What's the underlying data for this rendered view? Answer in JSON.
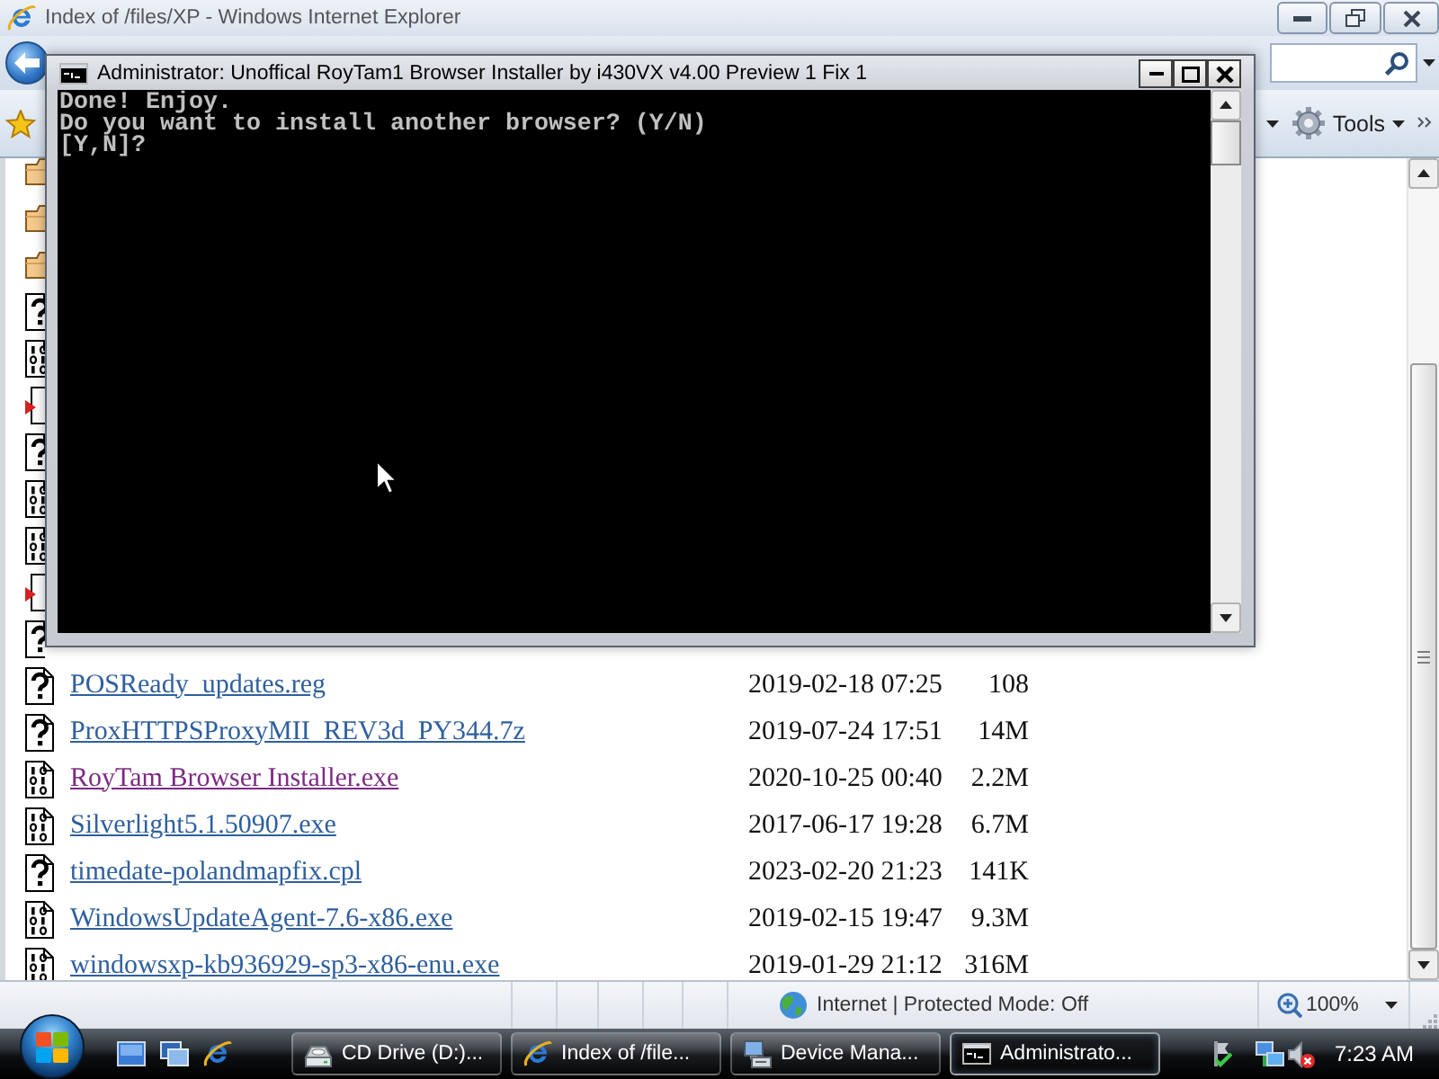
{
  "browser": {
    "title": "Index of /files/XP - Windows Internet Explorer",
    "command_bar": {
      "tools": "Tools"
    },
    "file_rows": [
      {
        "kind": "folder"
      },
      {
        "kind": "folder"
      },
      {
        "kind": "folder"
      },
      {
        "kind": "unknown"
      },
      {
        "kind": "binary"
      },
      {
        "kind": "arrow"
      },
      {
        "kind": "unknown"
      },
      {
        "kind": "binary"
      },
      {
        "kind": "binary"
      },
      {
        "kind": "arrow"
      },
      {
        "kind": "unknown"
      },
      {
        "kind": "unknown",
        "name": "POSReady_updates.reg",
        "modified": "2019-02-18 07:25",
        "size": "108",
        "visited": false
      },
      {
        "kind": "unknown",
        "name": "ProxHTTPSProxyMII_REV3d_PY344.7z",
        "modified": "2019-07-24 17:51",
        "size": "14M",
        "visited": false
      },
      {
        "kind": "binary",
        "name": "RoyTam Browser Installer.exe",
        "modified": "2020-10-25 00:40",
        "size": "2.2M",
        "visited": true
      },
      {
        "kind": "binary",
        "name": "Silverlight5.1.50907.exe",
        "modified": "2017-06-17 19:28",
        "size": "6.7M",
        "visited": false
      },
      {
        "kind": "unknown",
        "name": "timedate-polandmapfix.cpl",
        "modified": "2023-02-20 21:23",
        "size": "141K",
        "visited": false
      },
      {
        "kind": "binary",
        "name": "WindowsUpdateAgent-7.6-x86.exe",
        "modified": "2019-02-15 19:47",
        "size": "9.3M",
        "visited": false
      },
      {
        "kind": "binary",
        "name": "windowsxp-kb936929-sp3-x86-enu.exe",
        "modified": "2019-01-29 21:12",
        "size": "316M",
        "visited": false
      }
    ],
    "status_bar": {
      "zone": "Internet | Protected Mode: Off",
      "zoom": "100%"
    }
  },
  "console": {
    "title": "Administrator: Unoffical RoyTam1 Browser Installer by i430VX v4.00 Preview 1 Fix 1",
    "lines": [
      "Done! Enjoy.",
      "Do you want to install another browser? (Y/N)",
      "[Y,N]?"
    ]
  },
  "taskbar": {
    "buttons": [
      {
        "kind": "drive",
        "label": "CD Drive (D:)...",
        "selected": false
      },
      {
        "kind": "browser",
        "label": "Index of /file...",
        "selected": false
      },
      {
        "kind": "devices",
        "label": "Device Mana...",
        "selected": false
      },
      {
        "kind": "console",
        "label": "Administrato...",
        "selected": true
      }
    ],
    "clock": "7:23 AM"
  }
}
